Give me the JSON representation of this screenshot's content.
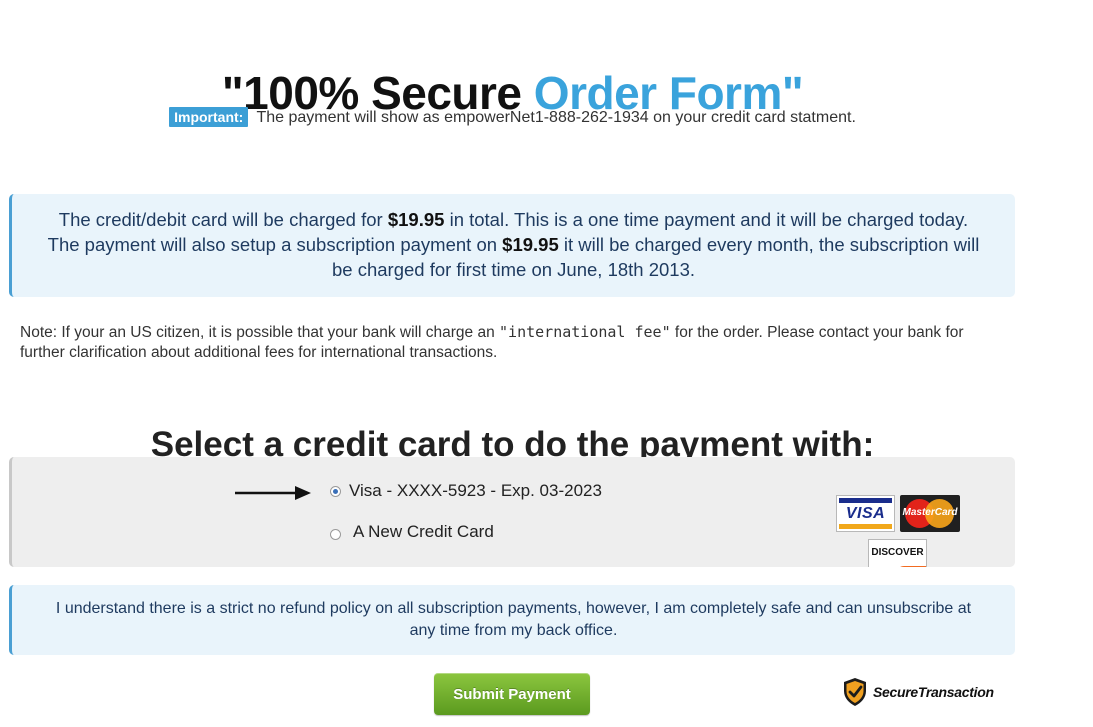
{
  "header": {
    "title_part1": "\"100% Secure ",
    "title_part2": "Order Form\"",
    "accent_color": "#3aa3dc"
  },
  "important": {
    "badge": "Important:",
    "text": "The payment will show as empowerNet1-888-262-1934 on your credit card statment."
  },
  "charge_notice": {
    "part1": "The credit/debit card will be charged for ",
    "amount1": "$19.95",
    "part2": " in total. This is a one time payment and it will be charged today. The payment will also setup a subscription payment on ",
    "amount2": "$19.95",
    "part3": " it will be charged every month, the subscription will be charged for first time on June, 18th 2013."
  },
  "note": {
    "part1": "Note: If your an US citizen, it is possible that your bank will charge an ",
    "fee": "\"international fee\"",
    "part2": " for the order. Please contact your bank for further clarification about additional fees for international transactions."
  },
  "card_selection": {
    "heading": "Select a credit card to do the payment with:",
    "options": [
      {
        "label": "Visa - XXXX-5923 - Exp. 03-2023",
        "selected": true
      },
      {
        "label": "A New Credit Card",
        "selected": false
      }
    ],
    "logos": {
      "visa": "VISA",
      "mastercard": "MasterCard",
      "discover": "DISCOVER"
    },
    "arrow_icon": "arrow-right-icon"
  },
  "refund_notice": {
    "text": "I understand there is a strict no refund policy on all subscription payments, however, I am completely safe and can unsubscribe at any time from my back office."
  },
  "submit": {
    "label": "Submit Payment",
    "color": "#6aab2a"
  },
  "secure_badge": {
    "text": "SecureTransaction",
    "icon": "shield-check-icon"
  }
}
